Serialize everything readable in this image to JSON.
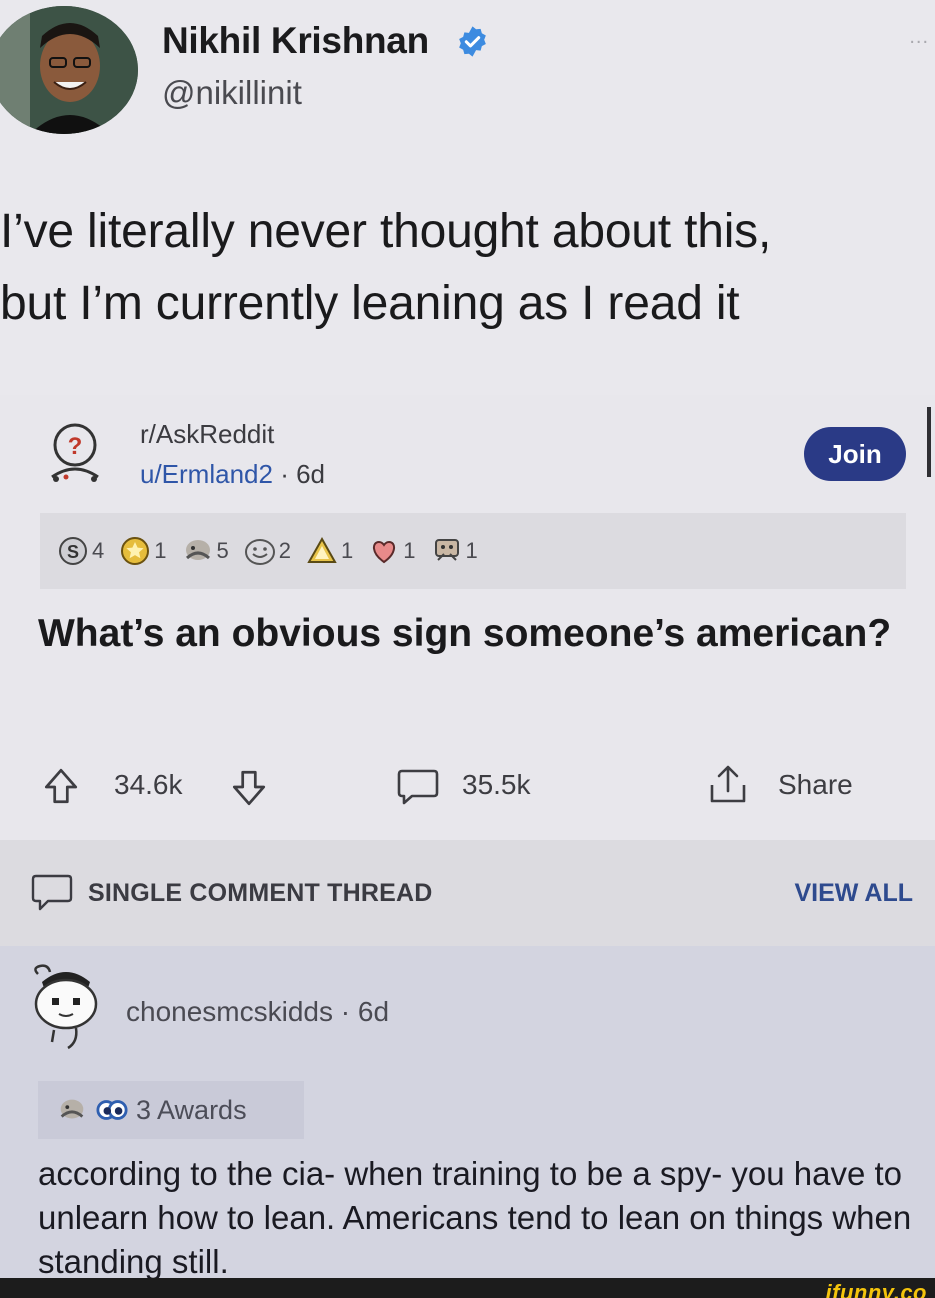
{
  "tweet": {
    "author_name": "Nikhil Krishnan",
    "author_handle": "@nikillinit",
    "more_label": "...",
    "text_line1": "I’ve literally never thought about this,",
    "text_line2": "but I’m currently leaning as I read it"
  },
  "reddit_post": {
    "subreddit": "r/AskReddit",
    "user": "u/Ermland2",
    "age": " · 6d",
    "join_label": "Join",
    "awards": [
      {
        "icon": "silver-award-icon",
        "count": "4"
      },
      {
        "icon": "gold-award-icon",
        "count": "1"
      },
      {
        "icon": "facepalm-award-icon",
        "count": "5"
      },
      {
        "icon": "wholesome-award-icon",
        "count": "2"
      },
      {
        "icon": "helpful-award-icon",
        "count": "1"
      },
      {
        "icon": "heart-award-icon",
        "count": "1"
      },
      {
        "icon": "table-flip-award-icon",
        "count": "1"
      }
    ],
    "title": "What’s an obvious sign someone’s american?",
    "upvotes": "34.6k",
    "comments": "35.5k",
    "share_label": "Share"
  },
  "thread": {
    "label": "SINGLE COMMENT THREAD",
    "view_all": "VIEW ALL"
  },
  "comment": {
    "username": "chonesmcskidds",
    "age": " · 6d",
    "awards_label": "3 Awards",
    "body": "according to the cia- when training to be a spy- you have to unlearn how to lean. Americans tend to lean on things when standing still."
  },
  "watermark": "ifunny.co",
  "colors": {
    "background": "#e9e8ed",
    "join_button": "#2a3a86",
    "link_blue": "#2f56a8",
    "comment_bg": "#d3d4e0",
    "watermark": "#f4c40c"
  }
}
